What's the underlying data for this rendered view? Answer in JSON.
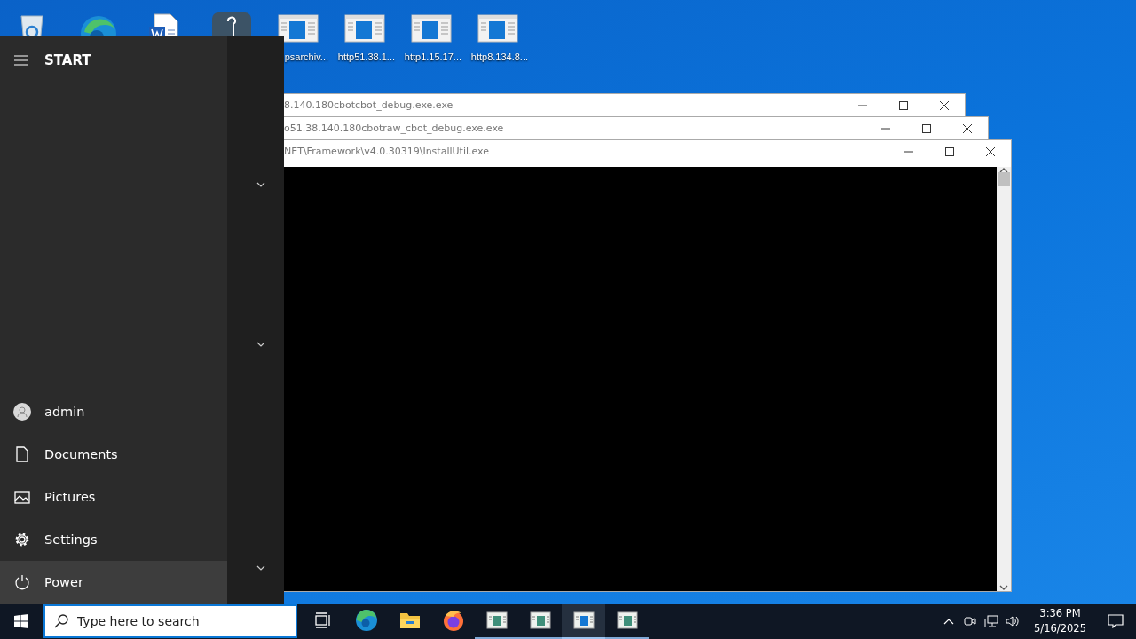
{
  "desktop": {
    "icons": [
      {
        "kind": "recycle-bin"
      },
      {
        "kind": "edge"
      },
      {
        "kind": "word"
      },
      {
        "kind": "hook-app"
      },
      {
        "kind": "document",
        "label": "psarchiv..."
      },
      {
        "kind": "document",
        "label": "http51.38.1..."
      },
      {
        "kind": "document",
        "label": "http1.15.17..."
      },
      {
        "kind": "document",
        "label": "http8.134.8..."
      }
    ]
  },
  "windows": [
    {
      "title": "8.140.180cbotcbot_debug.exe.exe"
    },
    {
      "title": "o51.38.140.180cbotraw_cbot_debug.exe.exe"
    },
    {
      "title": "NET\\Framework\\v4.0.30319\\InstallUtil.exe"
    }
  ],
  "start_menu": {
    "title": "START",
    "items": [
      {
        "kind": "user",
        "label": "admin",
        "selected": false
      },
      {
        "kind": "documents",
        "label": "Documents",
        "selected": false
      },
      {
        "kind": "pictures",
        "label": "Pictures",
        "selected": false
      },
      {
        "kind": "settings",
        "label": "Settings",
        "selected": false
      },
      {
        "kind": "power",
        "label": "Power",
        "selected": true
      }
    ]
  },
  "taskbar": {
    "search": {
      "placeholder": "Type here to search"
    },
    "apps": [
      {
        "kind": "task-view",
        "running": false,
        "active": false
      },
      {
        "kind": "edge",
        "running": false,
        "active": false
      },
      {
        "kind": "explorer",
        "running": false,
        "active": false
      },
      {
        "kind": "firefox",
        "running": false,
        "active": false
      },
      {
        "kind": "console",
        "running": true,
        "active": false
      },
      {
        "kind": "console",
        "running": true,
        "active": false
      },
      {
        "kind": "console",
        "running": true,
        "active": true
      },
      {
        "kind": "console",
        "running": true,
        "active": false
      }
    ],
    "time": "3:36 PM",
    "date": "5/16/2025"
  }
}
